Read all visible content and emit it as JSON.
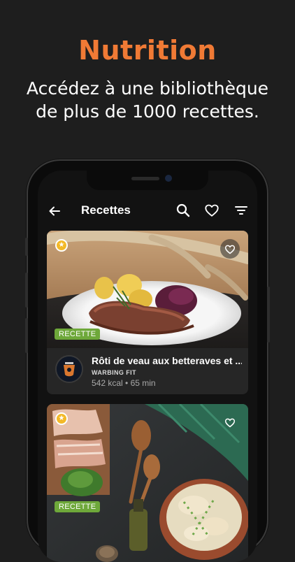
{
  "hero": {
    "title": "Nutrition",
    "subtitle_line1": "Accédez à une bibliothèque",
    "subtitle_line2": "de plus de 1000 recettes."
  },
  "appbar": {
    "title": "Recettes",
    "icons": [
      "back-arrow-icon",
      "search-icon",
      "heart-icon",
      "filter-icon"
    ]
  },
  "recipes": [
    {
      "name": "Rôti de veau aux betteraves et ...",
      "author": "WARBING FIT",
      "meta": "542 kcal • 65 min",
      "tag": "RECETTE"
    },
    {
      "tag": "RECETTE"
    }
  ],
  "colors": {
    "accent": "#f07a35",
    "tag": "#6ea83a",
    "star": "#f3b928",
    "background": "#1e1e1e"
  }
}
